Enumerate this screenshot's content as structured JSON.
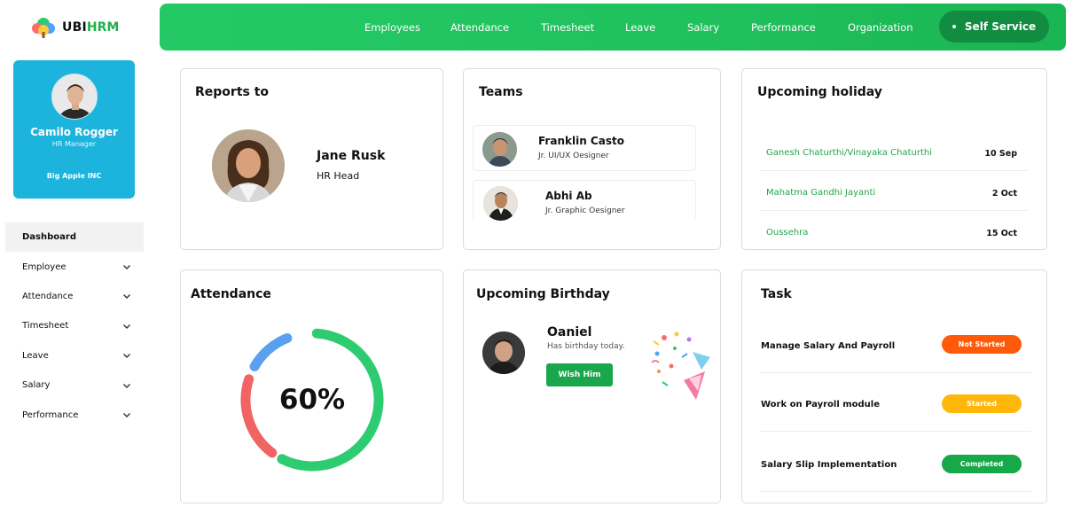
{
  "brand": {
    "part1": "UBI",
    "part2": "HRM"
  },
  "profile": {
    "name": "Camilo Rogger",
    "role": "HR Manager",
    "org": "Big Apple INC"
  },
  "sidebar": {
    "items": [
      {
        "label": "Dashboard",
        "active": true,
        "expandable": false
      },
      {
        "label": "Employee",
        "expandable": true
      },
      {
        "label": "Attendance",
        "expandable": true
      },
      {
        "label": "Timesheet",
        "expandable": true
      },
      {
        "label": "Leave",
        "expandable": true
      },
      {
        "label": "Salary",
        "expandable": true
      },
      {
        "label": "Performance",
        "expandable": true
      }
    ]
  },
  "topnav": {
    "links": [
      "Employees",
      "Attendance",
      "Timesheet",
      "Leave",
      "Salary",
      "Performance",
      "Organization"
    ],
    "self_service": "Self Service"
  },
  "reports_to": {
    "title": "Reports to",
    "name": "Jane Rusk",
    "role": "HR Head"
  },
  "teams": {
    "title": "Teams",
    "members": [
      {
        "name": "Franklin Casto",
        "role": "Jr. UI/UX Oesigner"
      },
      {
        "name": "Abhi Ab",
        "role": "Jr. Graphic Oesigner"
      }
    ]
  },
  "holidays": {
    "title": "Upcoming holiday",
    "items": [
      {
        "name": "Ganesh Chaturthi/Vinayaka Chaturthi",
        "date": "10 Sep"
      },
      {
        "name": "Mahatma Gandhi Jayanti",
        "date": "2 Oct"
      },
      {
        "name": "Oussehra",
        "date": "15 Oct"
      }
    ]
  },
  "attendance": {
    "title": "Attendance",
    "percent_label": "60%",
    "percent": 60
  },
  "birthday": {
    "title": "Upcoming Birthday",
    "name": "Oaniel",
    "sub": "Has birthday today.",
    "button": "Wish Him"
  },
  "tasks": {
    "title": "Task",
    "items": [
      {
        "name": "Manage Salary And Payroll",
        "status": "Not Started",
        "color": "#ff5a0a"
      },
      {
        "name": "Work on Payroll module",
        "status": "Started",
        "color": "#ffb80a"
      },
      {
        "name": "Salary Slip Implementation",
        "status": "Completed",
        "color": "#17a84a"
      }
    ]
  },
  "colors": {
    "accent": "#22c55e",
    "profile_bg": "#1cb3dd",
    "donut_green": "#2ecc71",
    "donut_red": "#f06060",
    "donut_blue": "#5aa0f0"
  }
}
